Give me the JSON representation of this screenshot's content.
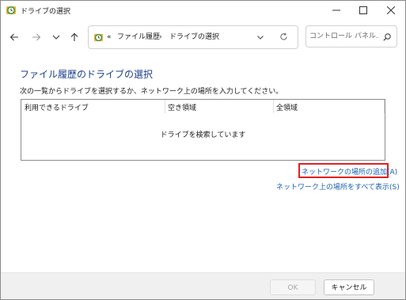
{
  "window": {
    "title": "ドライブの選択"
  },
  "navigation": {
    "address": {
      "prefix": "«",
      "crumbs": [
        "ファイル履歴",
        "ドライブの選択"
      ],
      "separator": "›"
    },
    "search_placeholder": "コントロール パネル..."
  },
  "main": {
    "heading": "ファイル履歴のドライブの選択",
    "instruction": "次の一覧からドライブを選択するか、ネットワーク上の場所を入力してください。",
    "table": {
      "columns": [
        "利用できるドライブ",
        "空き領域",
        "全領域"
      ],
      "empty_message": "ドライブを検索しています"
    },
    "links": {
      "add_network": "ネットワークの場所の追加(A)",
      "show_all_network": "ネットワーク上の場所をすべて表示(S)"
    }
  },
  "footer": {
    "ok_label": "OK",
    "cancel_label": "キャンセル"
  },
  "colors": {
    "heading": "#1c3f8f",
    "link": "#1a5fb4",
    "highlight": "#e0201f"
  }
}
